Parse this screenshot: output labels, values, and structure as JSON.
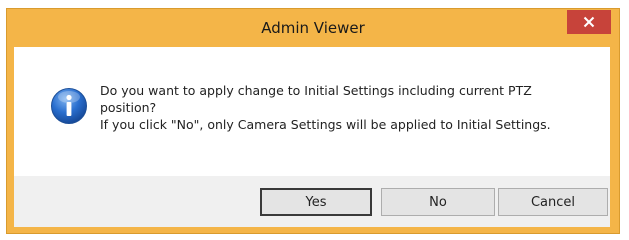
{
  "window": {
    "title": "Admin Viewer",
    "close_icon": "close-icon",
    "titlebar_color": "#f4b548",
    "close_color": "#c7433a"
  },
  "message": {
    "icon": "info-icon",
    "lines": [
      "Do you want to apply change to Initial Settings including current PTZ",
      "position?",
      "If you click \"No\", only Camera Settings will be applied to Initial Settings."
    ]
  },
  "buttons": {
    "yes": "Yes",
    "no": "No",
    "cancel": "Cancel"
  }
}
